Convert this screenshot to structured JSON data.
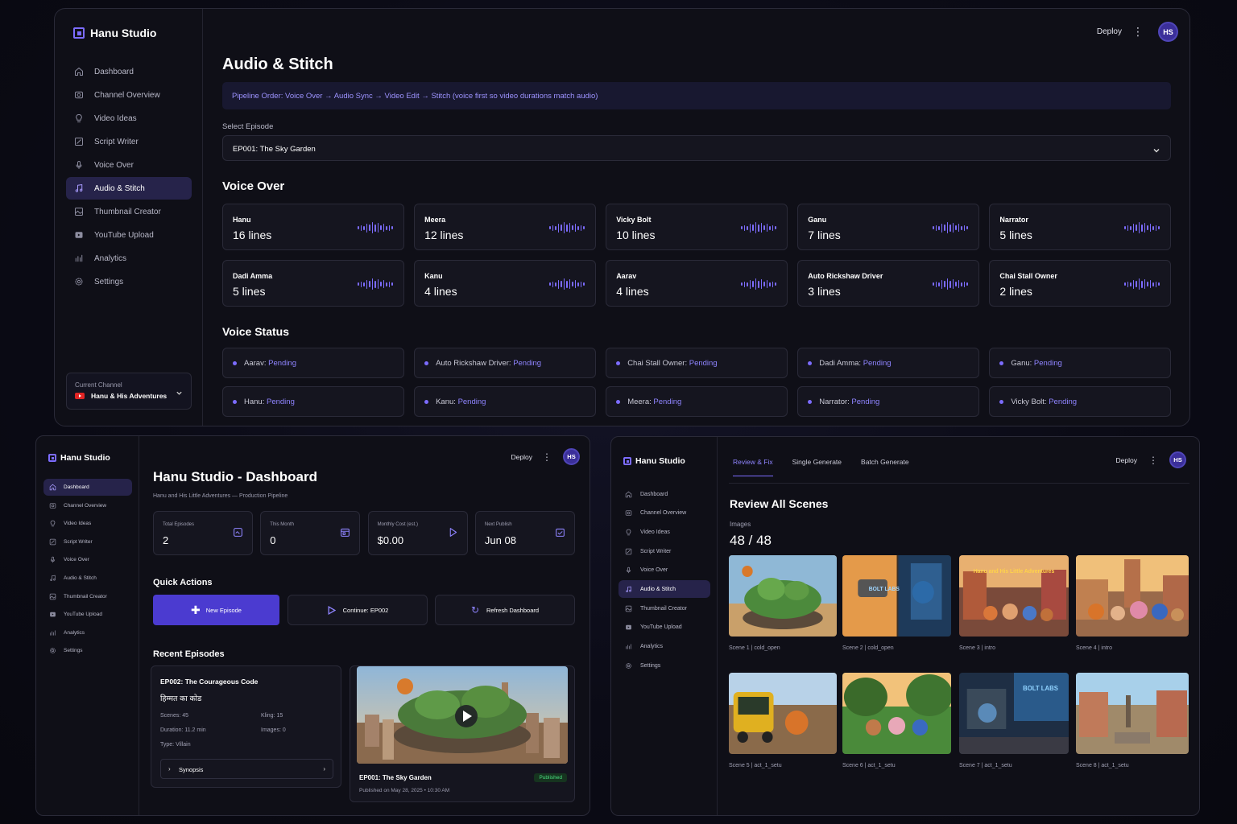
{
  "brand": "Hanu Studio",
  "colors": {
    "accent": "#7c6cff",
    "bg": "#0f0f17",
    "active": "#26234a",
    "published": "#4ade80"
  },
  "top": {
    "deploy": "Deploy",
    "avatar": "HS"
  },
  "nav": [
    {
      "label": "Dashboard",
      "icon": "home-icon"
    },
    {
      "label": "Channel Overview",
      "icon": "camera-icon"
    },
    {
      "label": "Video Ideas",
      "icon": "lightbulb-icon"
    },
    {
      "label": "Script Writer",
      "icon": "pencil-icon"
    },
    {
      "label": "Voice Over",
      "icon": "microphone-icon"
    },
    {
      "label": "Audio & Stitch",
      "icon": "music-icon"
    },
    {
      "label": "Thumbnail Creator",
      "icon": "image-icon"
    },
    {
      "label": "YouTube Upload",
      "icon": "upload-icon"
    },
    {
      "label": "Analytics",
      "icon": "bar-chart-icon"
    },
    {
      "label": "Settings",
      "icon": "gear-icon"
    }
  ],
  "main": {
    "title": "Audio & Stitch",
    "pipeline": "Pipeline Order: Voice Over → Audio Sync → Video Edit → Stitch (voice first so video durations match audio)",
    "select_label": "Select Episode",
    "selected_episode": "EP001: The Sky Garden",
    "voice_over_title": "Voice Over",
    "voices": [
      {
        "name": "Hanu",
        "lines": "16 lines"
      },
      {
        "name": "Meera",
        "lines": "12 lines"
      },
      {
        "name": "Vicky Bolt",
        "lines": "10 lines"
      },
      {
        "name": "Ganu",
        "lines": "7 lines"
      },
      {
        "name": "Narrator",
        "lines": "5 lines"
      },
      {
        "name": "Dadi Amma",
        "lines": "5 lines"
      },
      {
        "name": "Kanu",
        "lines": "4 lines"
      },
      {
        "name": "Aarav",
        "lines": "4 lines"
      },
      {
        "name": "Auto Rickshaw Driver",
        "lines": "3 lines"
      },
      {
        "name": "Chai Stall Owner",
        "lines": "2 lines"
      }
    ],
    "status_title": "Voice Status",
    "statuses": [
      {
        "name": "Aarav:",
        "state": "Pending"
      },
      {
        "name": "Auto Rickshaw Driver:",
        "state": "Pending"
      },
      {
        "name": "Chai Stall Owner:",
        "state": "Pending"
      },
      {
        "name": "Dadi Amma:",
        "state": "Pending"
      },
      {
        "name": "Ganu:",
        "state": "Pending"
      },
      {
        "name": "Hanu:",
        "state": "Pending"
      },
      {
        "name": "Kanu:",
        "state": "Pending"
      },
      {
        "name": "Meera:",
        "state": "Pending"
      },
      {
        "name": "Narrator:",
        "state": "Pending"
      },
      {
        "name": "Vicky Bolt:",
        "state": "Pending"
      }
    ],
    "channel_label": "Current Channel",
    "channel_name": "Hanu & His Adventures"
  },
  "dash": {
    "title": "Hanu Studio - Dashboard",
    "subtitle": "Hanu and His Little Adventures — Production Pipeline",
    "stats": [
      {
        "label": "Total Episodes",
        "value": "2",
        "icon": "film-icon"
      },
      {
        "label": "This Month",
        "value": "0",
        "icon": "calendar-icon"
      },
      {
        "label": "Monthly Cost (est.)",
        "value": "$0.00",
        "icon": "play-icon"
      },
      {
        "label": "Next Publish",
        "value": "Jun 08",
        "icon": "calendar-check-icon"
      }
    ],
    "quick_title": "Quick Actions",
    "actions": {
      "new": "New Episode",
      "continue": "Continue: EP002",
      "refresh": "Refresh Dashboard"
    },
    "recent_title": "Recent Episodes",
    "ep2": {
      "title": "EP002: The Courageous Code",
      "hindi": "हिम्मत का कोड",
      "scenes": "Scenes: 45",
      "kling": "Kling: 15",
      "duration": "Duration: 11.2 min",
      "images": "Images: 0",
      "type": "Type: Villain",
      "synopsis": "Synopsis"
    },
    "ep1": {
      "title": "EP001: The Sky Garden",
      "badge": "Published",
      "published": "Published on May 28, 2025 • 10:30 AM"
    }
  },
  "review": {
    "tabs": [
      "Review & Fix",
      "Single Generate",
      "Batch Generate"
    ],
    "title": "Review All Scenes",
    "images_label": "Images",
    "images_count": "48 / 48",
    "scenes": [
      "Scene 1 | cold_open",
      "Scene 2 | cold_open",
      "Scene 3 | intro",
      "Scene 4 | intro",
      "Scene 5 | act_1_setu",
      "Scene 6 | act_1_setu",
      "Scene 7 | act_1_setu",
      "Scene 8 | act_1_setu"
    ],
    "thumb_texts": {
      "s2": "BOLT LABS",
      "s3": "Hanu and His Little Adventures",
      "s7": "BOLT LABS"
    }
  }
}
